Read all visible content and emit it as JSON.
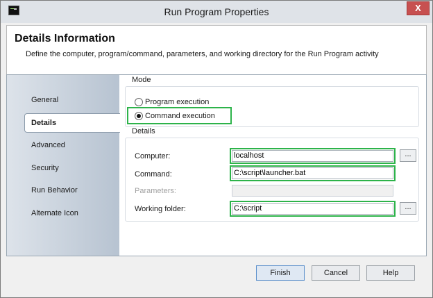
{
  "window": {
    "title": "Run Program Properties",
    "close_glyph": "X"
  },
  "header": {
    "title": "Details Information",
    "description": "Define the computer, program/command, parameters, and working directory for the Run Program activity"
  },
  "sidebar": {
    "items": [
      {
        "label": "General"
      },
      {
        "label": "Details",
        "active": true
      },
      {
        "label": "Advanced"
      },
      {
        "label": "Security"
      },
      {
        "label": "Run Behavior"
      },
      {
        "label": "Alternate Icon"
      }
    ]
  },
  "mode": {
    "label": "Mode",
    "options": [
      {
        "label": "Program execution",
        "checked": false
      },
      {
        "label": "Command execution",
        "checked": true
      }
    ]
  },
  "details": {
    "label": "Details",
    "fields": [
      {
        "label": "Computer:",
        "value": "localhost",
        "browse": "..."
      },
      {
        "label": "Command:",
        "value": "C:\\script\\launcher.bat"
      },
      {
        "label": "Parameters:",
        "value": "",
        "disabled": true
      },
      {
        "label": "Working folder:",
        "value": "C:\\script",
        "browse": "..."
      }
    ]
  },
  "footer": {
    "finish": "Finish",
    "cancel": "Cancel",
    "help": "Help"
  },
  "colors": {
    "highlight": "#2db34a",
    "close": "#c75050"
  }
}
